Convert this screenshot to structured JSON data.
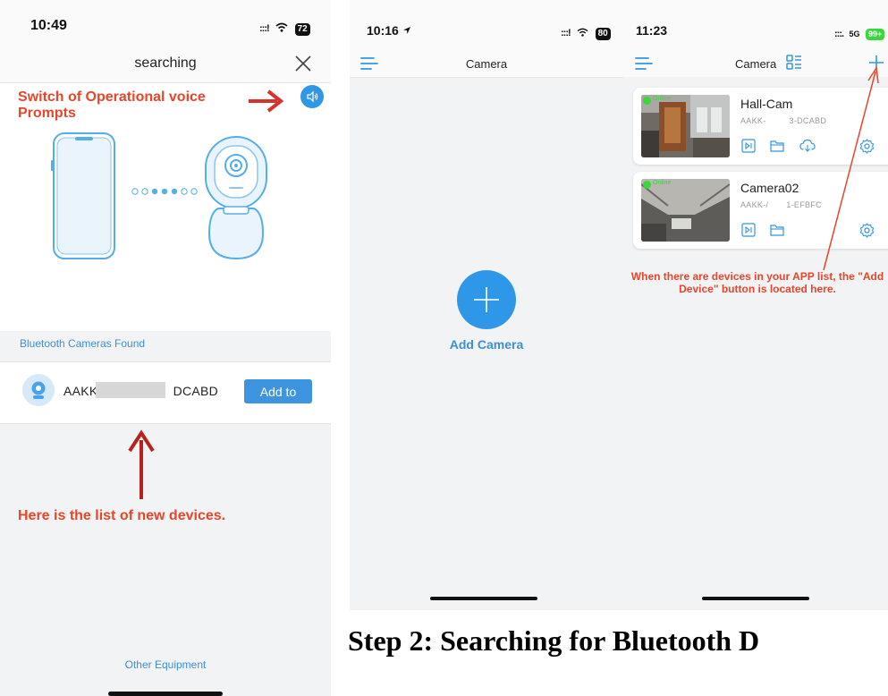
{
  "colors": {
    "accent": "#2f97e8",
    "link": "#3d8fd6",
    "annotation": "#e8452a",
    "online": "#3bd63b"
  },
  "screen1": {
    "status": {
      "time": "10:49",
      "signal": ":::!",
      "battery": "72"
    },
    "title": "searching",
    "annotation_top": "Switch of Operational voice Prompts",
    "section_header": "Bluetooth Cameras Found",
    "device": {
      "name_prefix": "AAKK",
      "name_suffix": "DCABD",
      "button": "Add to"
    },
    "annotation_bottom": "Here is the list of new devices.",
    "footer_link": "Other Equipment"
  },
  "screen2": {
    "status": {
      "time": "10:16",
      "signal": ":::!",
      "battery": "80"
    },
    "title": "Camera",
    "add_label": "Add Camera"
  },
  "screen3": {
    "status": {
      "time": "11:23",
      "signal": ":::.",
      "network": "5G",
      "battery": "99+"
    },
    "title": "Camera",
    "cameras": [
      {
        "name": "Hall-Cam",
        "id_prefix": "AAKK-",
        "id_suffix": "3-DCABD",
        "status": "Online"
      },
      {
        "name": "Camera02",
        "id_prefix": "AAKK-/",
        "id_suffix": "1-EFBFC",
        "status": "Online"
      }
    ],
    "annotation": "When there are devices in your APP list, the \"Add Device\" button is located here."
  },
  "caption": "Step 2: Searching for Bluetooth D"
}
